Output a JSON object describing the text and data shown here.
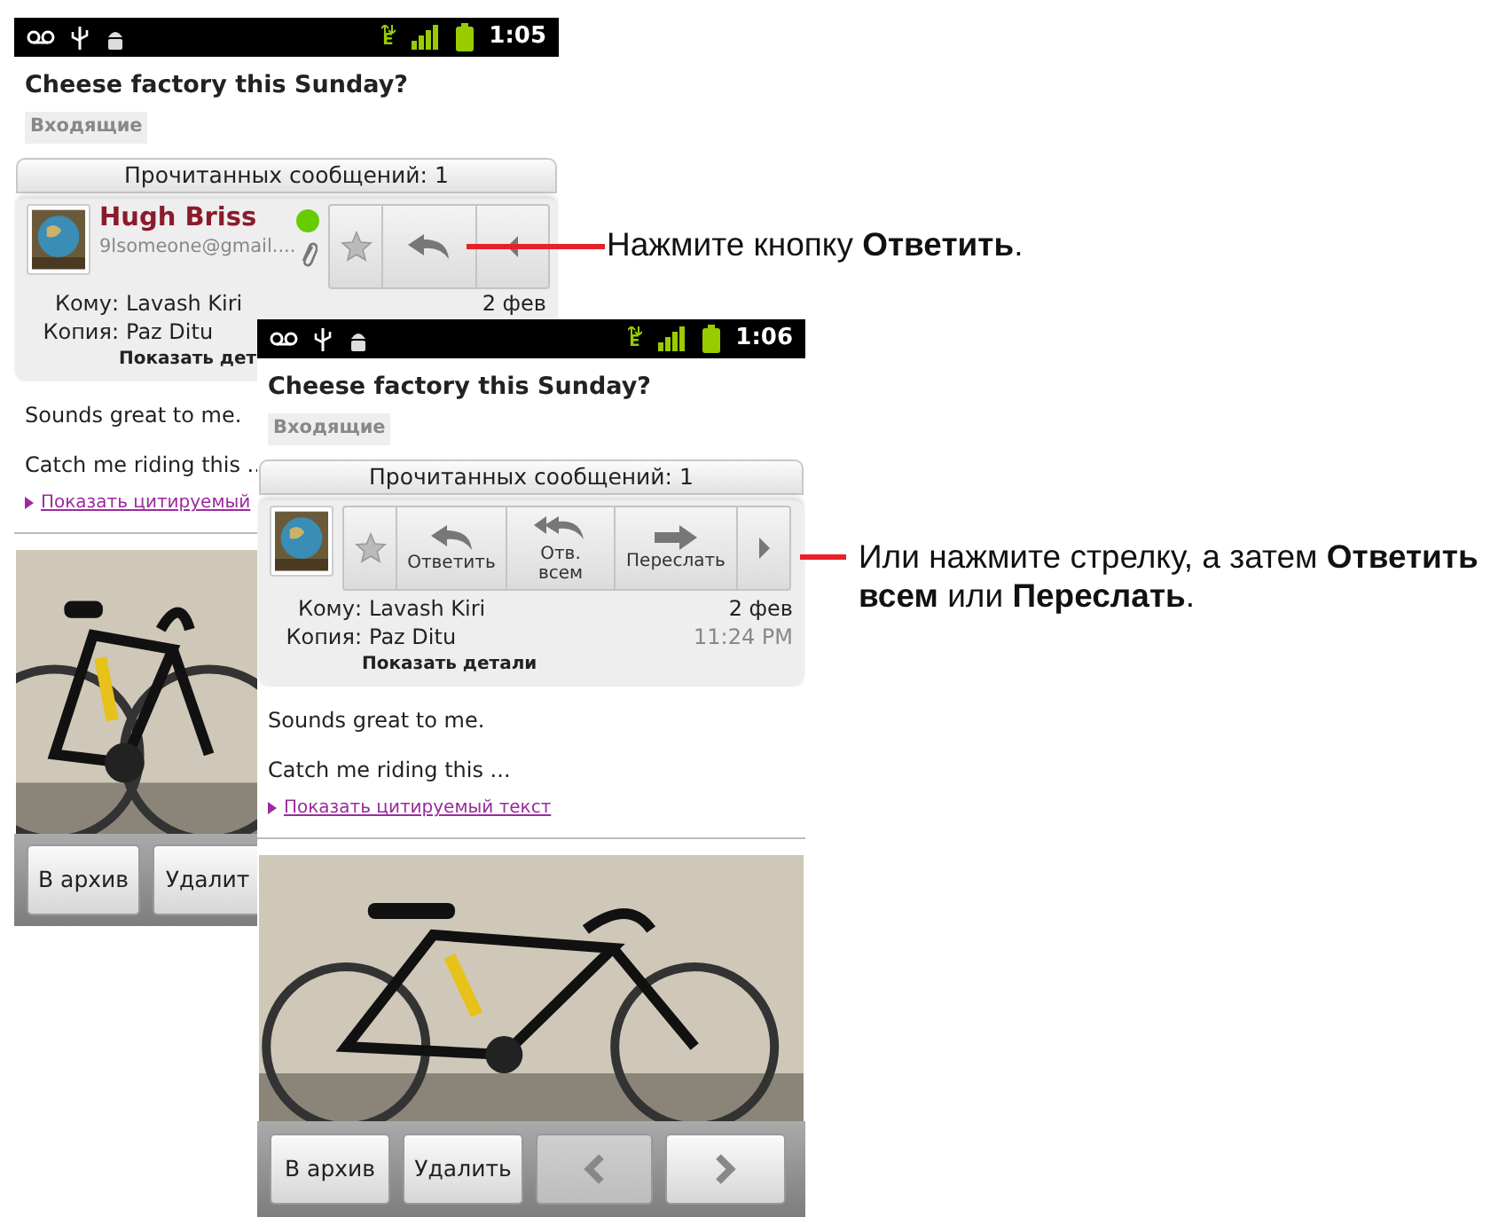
{
  "screens": [
    {
      "status_bar": {
        "network": "E",
        "time": "1:05"
      },
      "subject": "Cheese factory this Sunday?",
      "folder": "Входящие",
      "read_count": "Прочитанных сообщений: 1",
      "sender": {
        "name": "Hugh Briss",
        "email": "9lsomeone@gmail....",
        "online": true
      },
      "actions": [
        {
          "kind": "star",
          "starred": false
        },
        {
          "kind": "reply"
        },
        {
          "kind": "partial"
        }
      ],
      "recipients": [
        {
          "label": "Кому:",
          "value": "Lavash Kiri",
          "date": "2 фев"
        },
        {
          "label": "Копия:",
          "value": "Paz Ditu"
        }
      ],
      "details_link": "Показать дет",
      "body": [
        "Sounds great to me.",
        "Catch me riding this .."
      ],
      "quoted_link": "Показать цитируемый",
      "attachment": {
        "kind": "picture"
      },
      "buttons": [
        {
          "kind": "text",
          "label": "В архив"
        },
        {
          "kind": "text",
          "label": "Удалит"
        }
      ]
    },
    {
      "status_bar": {
        "network": "E",
        "time": "1:06"
      },
      "subject": "Cheese factory this Sunday?",
      "folder": "Входящие",
      "read_count": "Прочитанных сообщений: 1",
      "actions": [
        {
          "kind": "star",
          "starred": false
        },
        {
          "kind": "reply",
          "label": "Ответить"
        },
        {
          "kind": "reply_all",
          "label": "Отв. всем"
        },
        {
          "kind": "forward",
          "label": "Переслать"
        },
        {
          "kind": "more"
        }
      ],
      "recipients": [
        {
          "label": "Кому:",
          "value": "Lavash Kiri",
          "date": "2 фев"
        },
        {
          "label": "Копия:",
          "value": "Paz Ditu",
          "date": "11:24 PM"
        }
      ],
      "details_link": "Показать детали",
      "body": [
        "Sounds great to me.",
        "Catch me riding this ..."
      ],
      "quoted_link": "Показать цитируемый текст",
      "attachment": {
        "kind": "picture"
      },
      "buttons": [
        {
          "kind": "text",
          "label": "В архив"
        },
        {
          "kind": "text",
          "label": "Удалить"
        },
        {
          "kind": "prev",
          "disabled": true
        },
        {
          "kind": "next",
          "disabled": false
        }
      ]
    }
  ],
  "callouts": [
    {
      "text": "Нажмите кнопку **Ответить**."
    },
    {
      "text": "Или нажмите стрелку, а затем **Ответить всем** или **Переслать**."
    }
  ]
}
